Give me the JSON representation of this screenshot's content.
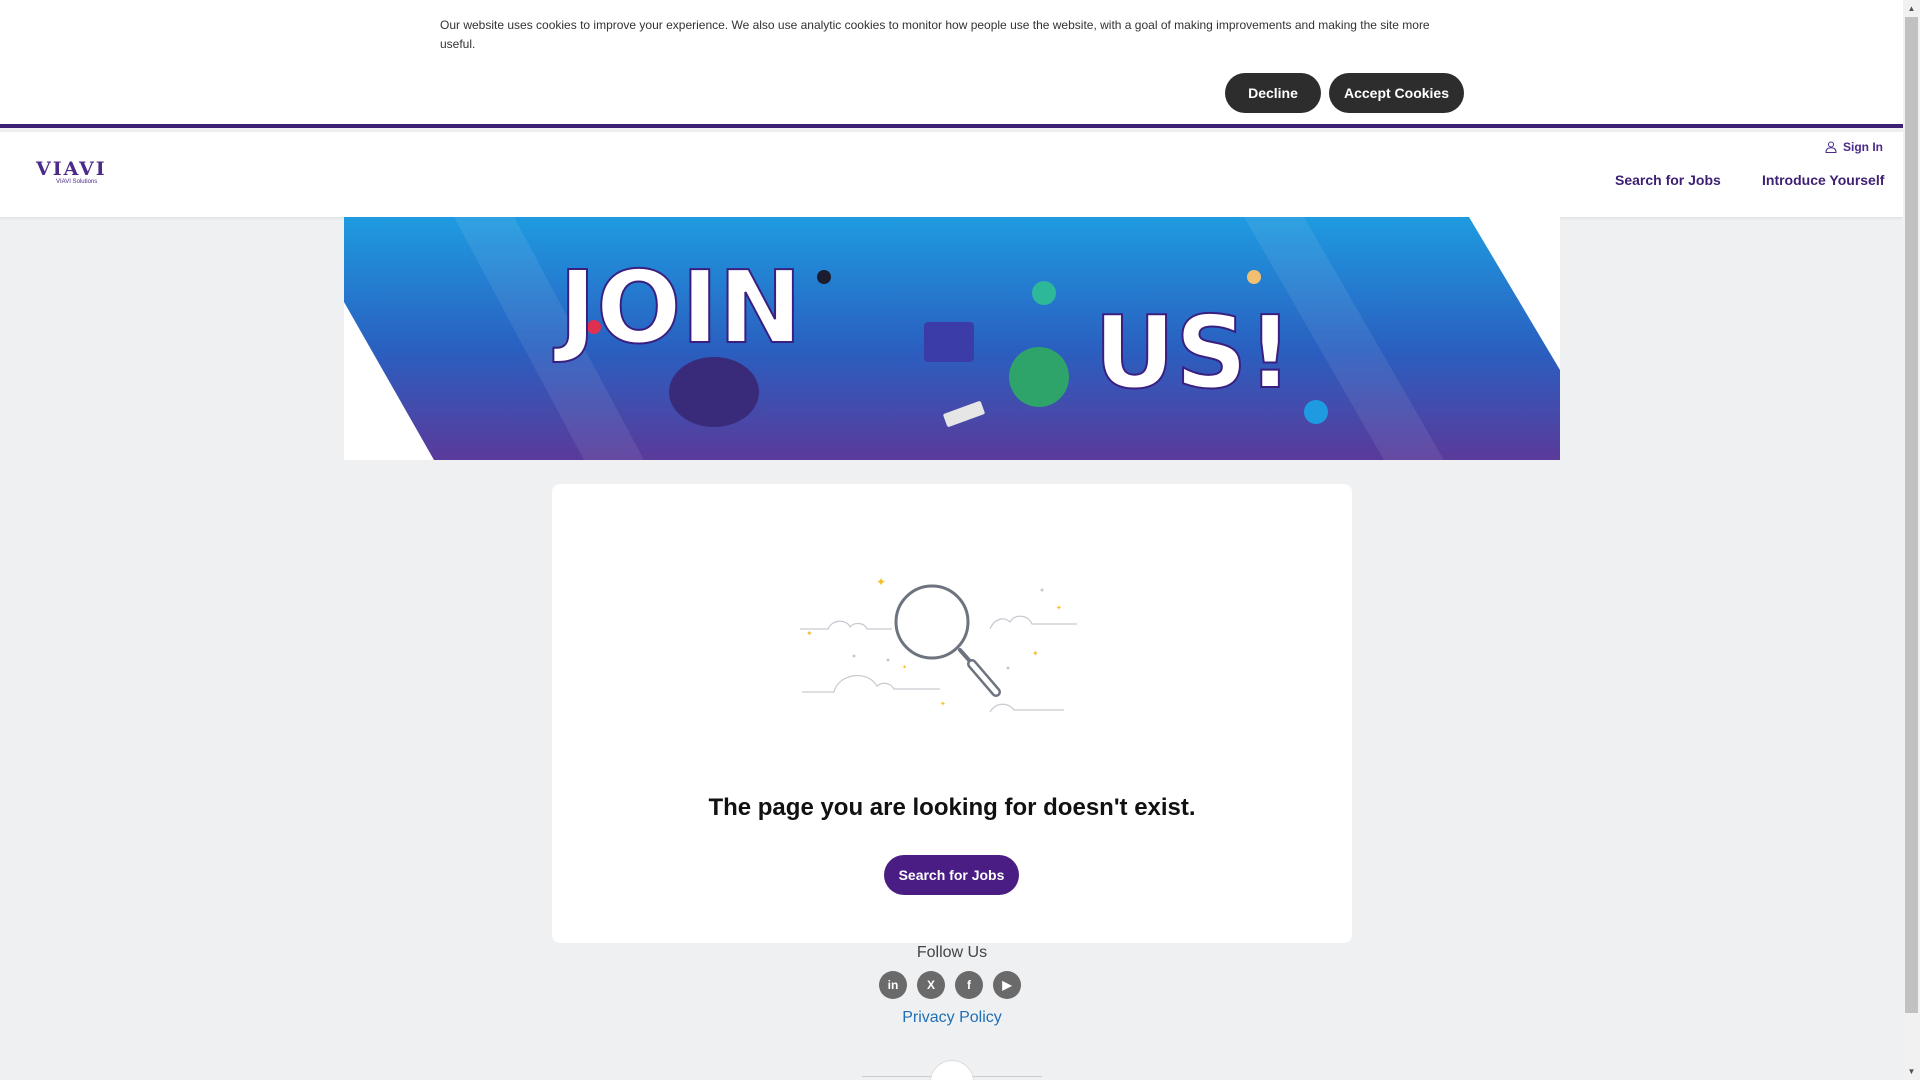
{
  "cookie_banner": {
    "text": "Our website uses cookies to improve your experience. We also use analytic cookies to monitor how people use the website, with a goal of making improvements and making the site more useful.",
    "decline_label": "Decline",
    "accept_label": "Accept Cookies"
  },
  "header": {
    "logo_text": "VIAVI",
    "logo_subtext": "VIAVI Solutions",
    "signin_label": "Sign In",
    "nav": {
      "search_jobs": "Search for Jobs",
      "introduce_yourself": "Introduce Yourself"
    }
  },
  "hero": {
    "word_join": "JOIN",
    "word_us": "US!"
  },
  "main": {
    "message": "The page you are looking for doesn't exist.",
    "button_label": "Search for Jobs"
  },
  "footer": {
    "follow_label": "Follow Us",
    "socials": [
      {
        "icon": "linkedin-icon",
        "glyph": "in"
      },
      {
        "icon": "x-icon",
        "glyph": "X"
      },
      {
        "icon": "facebook-icon",
        "glyph": "f"
      },
      {
        "icon": "youtube-icon",
        "glyph": "▶"
      }
    ],
    "privacy_label": "Privacy Policy"
  },
  "colors": {
    "brand_purple": "#4a1d85",
    "link_blue": "#1f6fb5",
    "dark_button": "#2d2d2d"
  }
}
